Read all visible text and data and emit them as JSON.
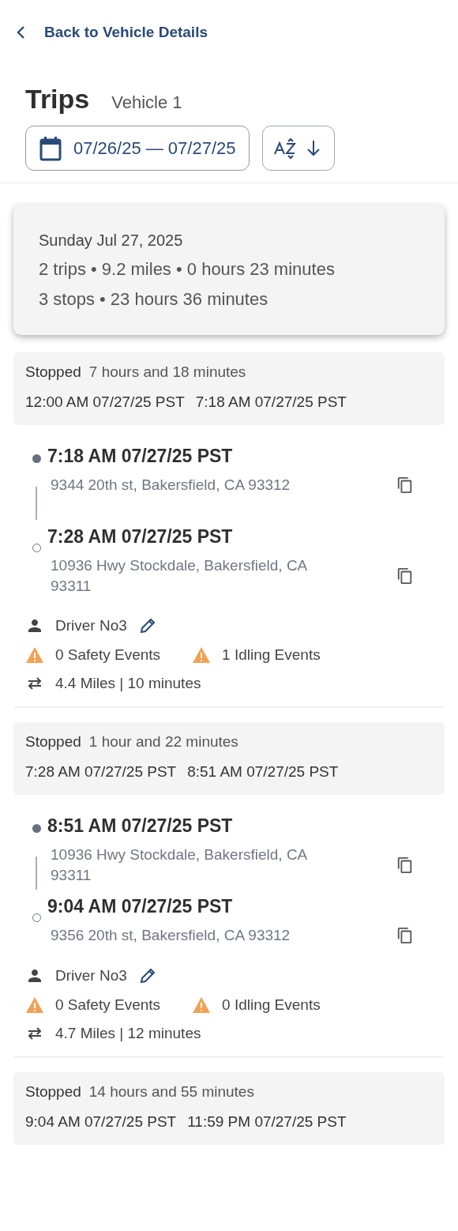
{
  "back_link": {
    "label": "Back to Vehicle Details"
  },
  "header": {
    "title": "Trips",
    "subtitle": "Vehicle 1"
  },
  "date_range": {
    "value": "07/26/25 — 07/27/25"
  },
  "summary": {
    "date": "Sunday Jul 27, 2025",
    "trips_line": "2 trips • 9.2 miles • 0 hours 23 minutes",
    "stops_line": "3 stops • 23 hours 36 minutes"
  },
  "timeline": [
    {
      "kind": "stop",
      "label": "Stopped",
      "duration": "7 hours and 18 minutes",
      "start": "12:00 AM 07/27/25 PST",
      "end": "7:18 AM 07/27/25 PST"
    },
    {
      "kind": "trip",
      "start_time": "7:18 AM 07/27/25 PST",
      "start_address": "9344 20th st, Bakersfield, CA 93312",
      "end_time": "7:28 AM 07/27/25 PST",
      "end_address": "10936 Hwy Stockdale, Bakersfield, CA 93311",
      "driver": "Driver No3",
      "safety_events": "0 Safety Events",
      "idling_events": "1 Idling Events",
      "distance": "4.4 Miles | 10 minutes"
    },
    {
      "kind": "stop",
      "label": "Stopped",
      "duration": "1 hour and 22 minutes",
      "start": "7:28 AM 07/27/25 PST",
      "end": "8:51 AM 07/27/25 PST"
    },
    {
      "kind": "trip",
      "start_time": "8:51 AM 07/27/25 PST",
      "start_address": "10936 Hwy Stockdale, Bakersfield, CA 93311",
      "end_time": "9:04 AM 07/27/25 PST",
      "end_address": "9356 20th st, Bakersfield, CA 93312",
      "driver": "Driver No3",
      "safety_events": "0 Safety Events",
      "idling_events": "0 Idling Events",
      "distance": "4.7 Miles | 12 minutes"
    },
    {
      "kind": "stop",
      "label": "Stopped",
      "duration": "14 hours and 55 minutes",
      "start": "9:04 AM 07/27/25 PST",
      "end": "11:59 PM 07/27/25 PST"
    }
  ]
}
